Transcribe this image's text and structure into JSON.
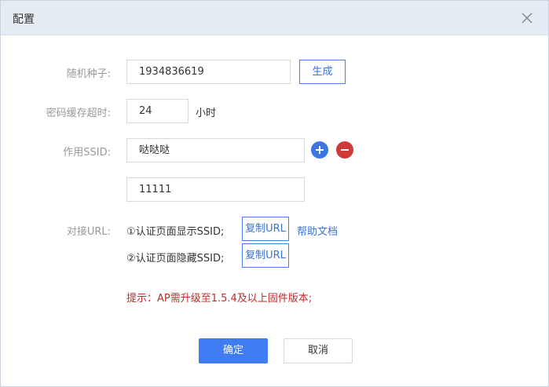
{
  "dialog": {
    "title": "配置",
    "close_icon": "close-icon"
  },
  "form": {
    "seed": {
      "label": "随机种子:",
      "value": "1934836619",
      "generate_label": "生成"
    },
    "cache": {
      "label": "密码缓存超时:",
      "value": "24",
      "unit": "小时"
    },
    "ssid": {
      "label": "作用SSID:",
      "values": [
        "哒哒哒",
        "11111"
      ],
      "add_icon": "plus-circle-icon",
      "remove_icon": "minus-circle-icon"
    },
    "url": {
      "label": "对接URL:",
      "show_text": "①认证页面显示SSID;",
      "hide_text": "②认证页面隐藏SSID;",
      "copy_label": "复制URL",
      "help_label": "帮助文档"
    },
    "tip": "提示：AP需升级至1.5.4及以上固件版本;"
  },
  "footer": {
    "confirm_label": "确定",
    "cancel_label": "取消"
  },
  "colors": {
    "accent": "#3f7cf1",
    "danger": "#cc3a3a",
    "warning_text": "#c22b2b",
    "header_bg": "#e6ecf3"
  }
}
